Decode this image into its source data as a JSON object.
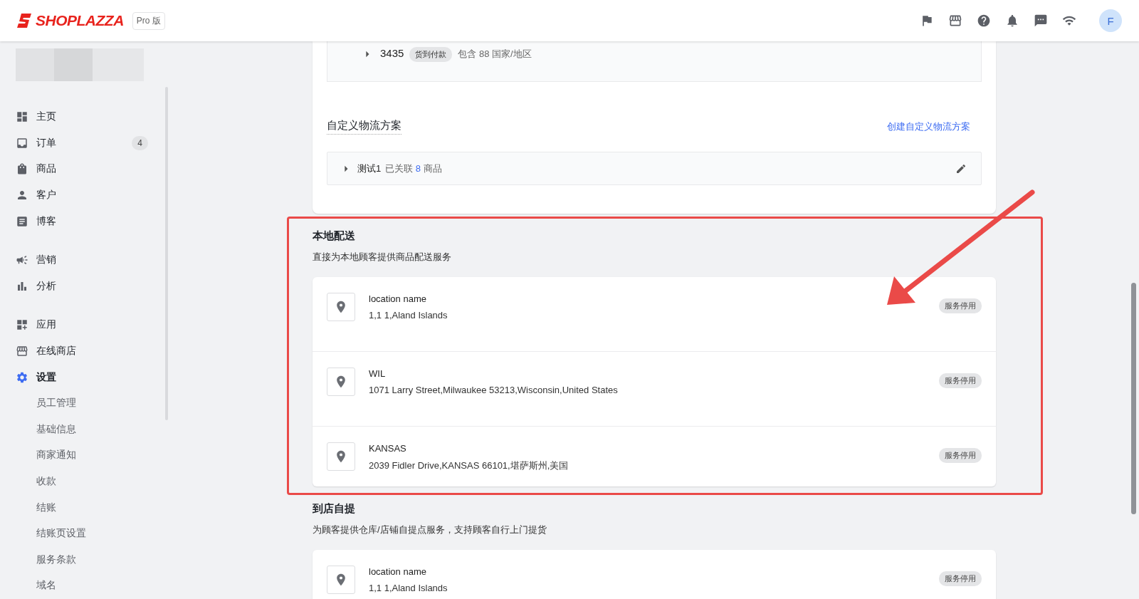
{
  "header": {
    "logo": "SHOPLAZZA",
    "plan": "Pro 版",
    "avatar": "F"
  },
  "sidebar": {
    "sections": [
      {
        "items": [
          {
            "label": "主页",
            "selected": false
          },
          {
            "label": "订单",
            "badge": "4",
            "selected": false
          },
          {
            "label": "商品",
            "selected": false
          },
          {
            "label": "客户",
            "selected": false
          },
          {
            "label": "博客",
            "selected": false
          }
        ]
      },
      {
        "items": [
          {
            "label": "营销",
            "selected": false
          },
          {
            "label": "分析",
            "selected": false
          }
        ]
      },
      {
        "items": [
          {
            "label": "应用",
            "selected": false
          },
          {
            "label": "在线商店",
            "selected": false
          },
          {
            "label": "设置",
            "selected": true,
            "expanded": true,
            "children": [
              {
                "label": "员工管理",
                "selected": false
              },
              {
                "label": "基础信息",
                "selected": false
              },
              {
                "label": "商家通知",
                "selected": false
              },
              {
                "label": "收款",
                "selected": false
              },
              {
                "label": "结账",
                "selected": false
              },
              {
                "label": "结账页设置",
                "selected": false
              },
              {
                "label": "服务条款",
                "selected": false
              },
              {
                "label": "域名",
                "selected": false
              }
            ]
          }
        ]
      }
    ]
  },
  "shipping_card": {
    "zone": {
      "name": "3435",
      "tag": "货到付款",
      "summary": "包含 88 国家/地区"
    },
    "custom_title": "自定义物流方案",
    "create_link": "创建自定义物流方案",
    "plans": [
      {
        "name": "测试1",
        "linked": "已关联",
        "count": "8",
        "unit": "商品"
      }
    ]
  },
  "sections": [
    {
      "title": "本地配送",
      "description": "直接为本地顾客提供商品配送服务",
      "locations": [
        {
          "name": "location name",
          "address": "1,1 1,Aland Islands",
          "status": "服务停用"
        },
        {
          "name": "WIL",
          "address": "1071 Larry Street,Milwaukee 53213,Wisconsin,United States",
          "status": "服务停用"
        },
        {
          "name": "KANSAS",
          "address": "2039 Fidler Drive,KANSAS 66101,堪萨斯州,美国",
          "status": "服务停用"
        }
      ]
    },
    {
      "title": "到店自提",
      "description": "为顾客提供仓库/店铺自提点服务，支持顾客自行上门提货",
      "locations": [
        {
          "name": "location name",
          "address": "1,1 1,Aland Islands",
          "status": "服务停用"
        }
      ]
    }
  ]
}
